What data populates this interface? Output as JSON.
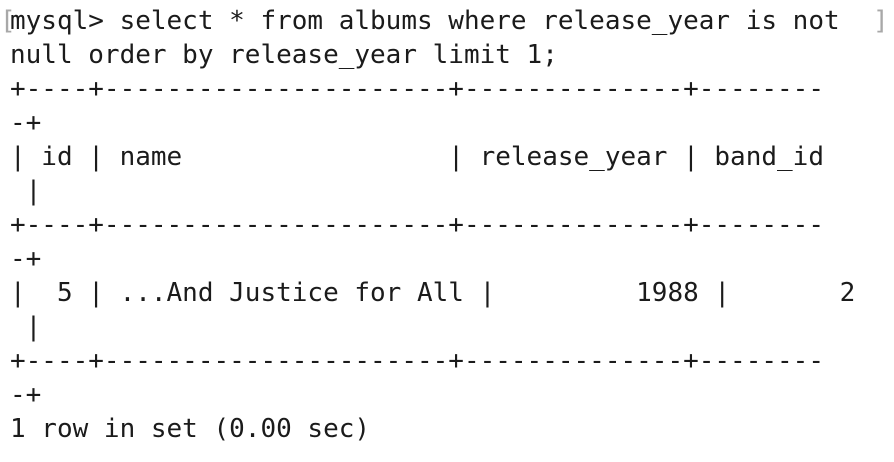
{
  "terminal": {
    "prompt_line_1": "mysql> select * from albums where release_year is not",
    "prompt_line_2": "null order by release_year limit 1;",
    "border_line_a": "+----+----------------------+--------------+--------",
    "border_line_b": "-+",
    "header_line_a": "| id | name                 | release_year | band_id",
    "header_line_b": " |",
    "row_line_a": "|  5 | ...And Justice for All |         1988 |       2",
    "row_line_b": " |",
    "status_line": "1 row in set (0.00 sec)",
    "cursor_left_glyph": "[",
    "cursor_right_glyph": "]"
  },
  "colors": {
    "background": "#ffffff",
    "text": "#1b1b1b",
    "faint_bracket": "#a8a8a8"
  }
}
